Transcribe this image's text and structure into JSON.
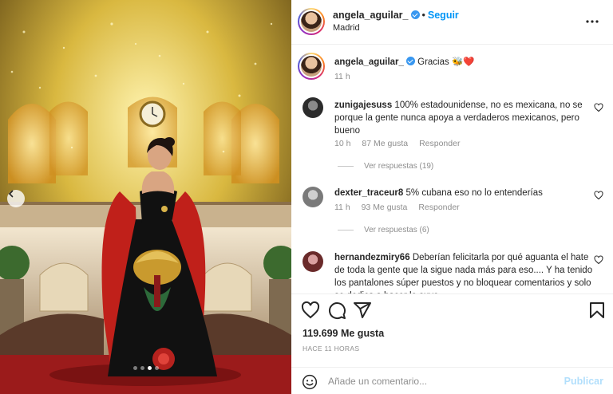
{
  "post": {
    "dots_count": 4,
    "active_dot": 2
  },
  "header": {
    "username": "angela_aguilar_",
    "follow_label": "Seguir",
    "separator": "•",
    "location": "Madrid"
  },
  "caption": {
    "username": "angela_aguilar_",
    "text": "Gracias 🐝❤️",
    "time": "11 h"
  },
  "comments": [
    {
      "username": "zunigajesuss",
      "text": "100% estadounidense, no es mexicana, no se porque la gente nunca apoya a verdaderos mexicanos, pero bueno",
      "time": "10 h",
      "likes": "87 Me gusta",
      "reply_label": "Responder",
      "view_replies": "Ver respuestas (19)"
    },
    {
      "username": "dexter_traceur8",
      "text": "5% cubana eso no lo entenderías",
      "time": "11 h",
      "likes": "93 Me gusta",
      "reply_label": "Responder",
      "view_replies": "Ver respuestas (6)"
    },
    {
      "username": "hernandezmiry66",
      "text": "Deberían felicitarla por qué aguanta el hate de toda la gente que la sigue nada más para eso.... Y ha tenido los pantalones súper puestos y no bloquear comentarios y solo se dedica a hacer lo suyo",
      "time": "",
      "likes": "",
      "reply_label": "",
      "view_replies": ""
    }
  ],
  "likes_count": "119.699 Me gusta",
  "post_time": "HACE 11 HORAS",
  "add_comment": {
    "placeholder": "Añade un comentario...",
    "publish_label": "Publicar"
  },
  "colors": {
    "link": "#0095f6",
    "muted": "#8e8e8e",
    "verified": "#3897f0",
    "publish_disabled": "#b2dffc",
    "heart": "#ed4956"
  },
  "icons": [
    "chevron-left-icon",
    "more-icon",
    "verified-icon",
    "heart-icon",
    "comment-icon",
    "share-icon",
    "bookmark-icon",
    "emoji-icon"
  ]
}
